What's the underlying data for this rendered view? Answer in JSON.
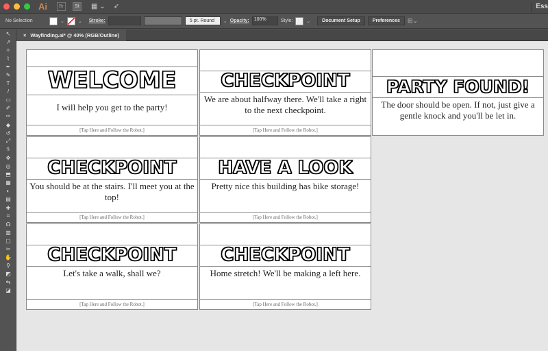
{
  "app": {
    "logo": "Ai",
    "bridge": "Br",
    "stock": "St",
    "workspace": "Ess"
  },
  "control": {
    "selection": "No Selection",
    "stroke_label": "Stroke:",
    "brush": "5 pt. Round",
    "opacity_label": "Opacity:",
    "opacity": "100%",
    "style_label": "Style:",
    "doc_setup": "Document Setup",
    "preferences": "Preferences"
  },
  "tab": {
    "close": "×",
    "title": "Wayfinding.ai* @ 40% (RGB/Outline)"
  },
  "artboards": [
    {
      "title": "WELCOME",
      "body": "I will help you get to the party!",
      "footer": "[Tap Here and Follow the Robot.]"
    },
    {
      "title": "CHECKPOINT",
      "body": "We are about halfway there. We'll take a right to the next checkpoint.",
      "footer": "[Tap Here and Follow the Robot.]"
    },
    {
      "title": "PARTY FOUND!",
      "body": "The door should be open. If not, just give a gentle knock and you'll be let in."
    },
    {
      "title": "CHECKPOINT",
      "body": "You should be at the stairs. I'll meet you at the top!",
      "footer": "[Tap Here and Follow the Robot.]"
    },
    {
      "title": "HAVE A LOOK",
      "body": "Pretty nice this building has bike storage!",
      "footer": "[Tap Here and Follow the Robot.]"
    },
    {
      "title": "CHECKPOINT",
      "body": "Let's take a walk, shall we?",
      "footer": "[Tap Here and Follow the Robot.]"
    },
    {
      "title": "CHECKPOINT",
      "body": "Home stretch! We'll be making a left here.",
      "footer": "[Tap Here and Follow the Robot.]"
    }
  ]
}
